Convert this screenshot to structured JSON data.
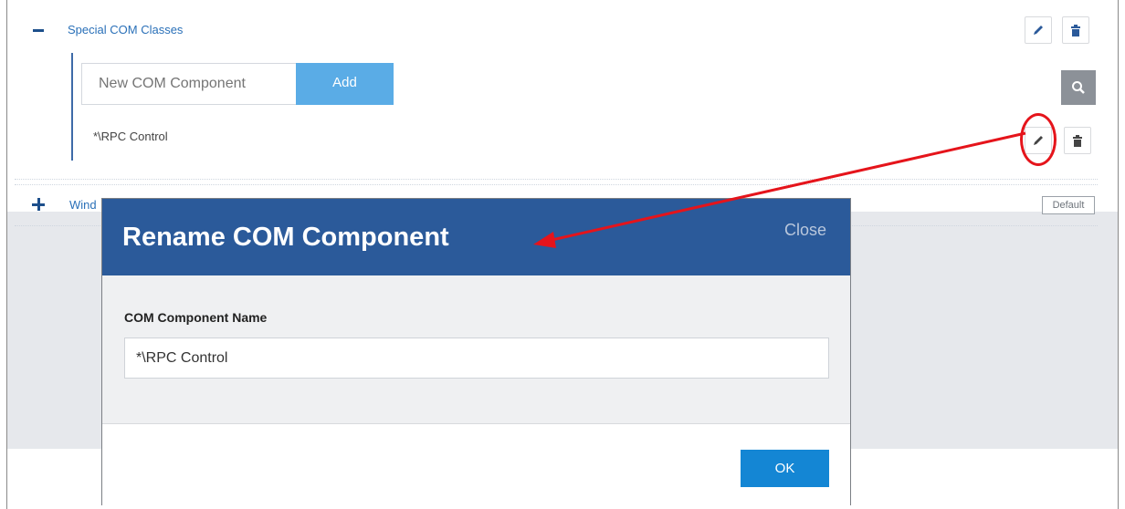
{
  "tree": {
    "group1_label": "Special COM Classes",
    "group2_label_partial": "Wind",
    "new_component_placeholder": "New COM Component",
    "add_label": "Add",
    "item_label": "*\\RPC Control",
    "default_tag": "Default"
  },
  "dialog": {
    "title": "Rename COM Component",
    "close_label": "Close",
    "field_label": "COM Component Name",
    "field_value": "*\\RPC Control",
    "ok_label": "OK"
  },
  "colors": {
    "dialog_header": "#2b5a9a",
    "accent_blue": "#5aace6",
    "ok_button": "#1486d4",
    "annotation_red": "#e5141b"
  },
  "icons": {
    "edit": "pencil-icon",
    "delete": "trash-icon",
    "search": "search-icon",
    "expand": "plus-icon",
    "collapse": "minus-icon"
  }
}
